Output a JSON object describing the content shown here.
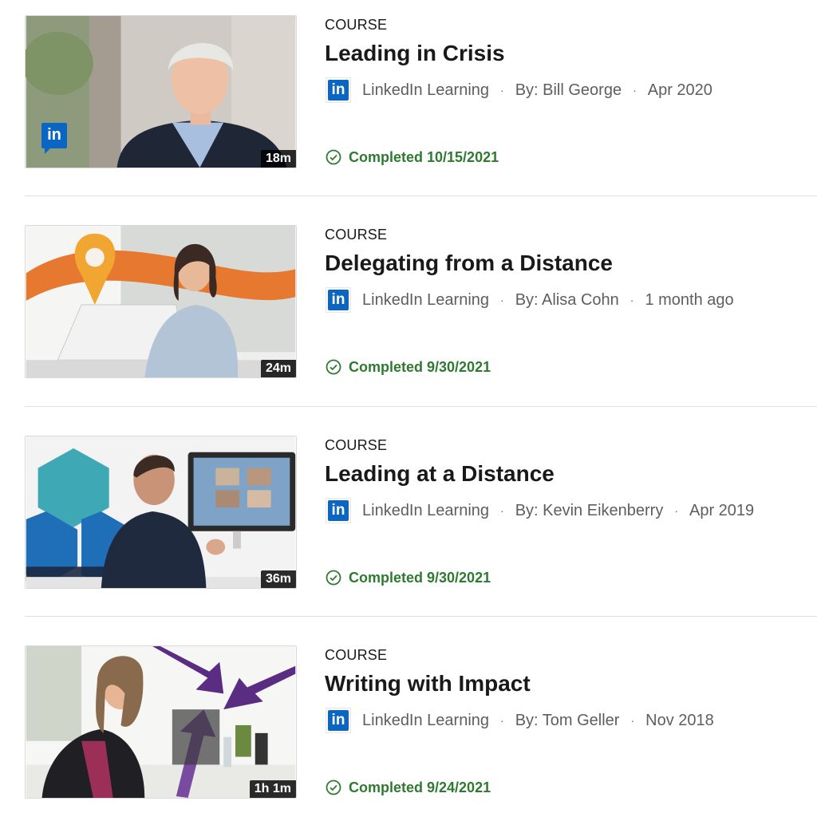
{
  "courses": [
    {
      "type": "COURSE",
      "title": "Leading in Crisis",
      "provider": "LinkedIn Learning",
      "author": "By: Bill George",
      "date": "Apr 2020",
      "duration": "18m",
      "status": "Completed 10/15/2021",
      "logo_text": "in",
      "thumbnail_badge": "in"
    },
    {
      "type": "COURSE",
      "title": "Delegating from a Distance",
      "provider": "LinkedIn Learning",
      "author": "By: Alisa Cohn",
      "date": "1 month ago",
      "duration": "24m",
      "status": "Completed 9/30/2021",
      "logo_text": "in"
    },
    {
      "type": "COURSE",
      "title": "Leading at a Distance",
      "provider": "LinkedIn Learning",
      "author": "By: Kevin Eikenberry",
      "date": "Apr 2019",
      "duration": "36m",
      "status": "Completed 9/30/2021",
      "logo_text": "in"
    },
    {
      "type": "COURSE",
      "title": "Writing with Impact",
      "provider": "LinkedIn Learning",
      "author": "By: Tom Geller",
      "date": "Nov 2018",
      "duration": "1h 1m",
      "status": "Completed 9/24/2021",
      "logo_text": "in"
    }
  ],
  "separator": "·",
  "icons": {
    "provider": "linkedin-logo-icon",
    "status": "check-circle-icon"
  },
  "colors": {
    "linkedin_blue": "#0a66c2",
    "completed_green": "#2f7a30",
    "meta_gray": "#5e5e5e"
  }
}
